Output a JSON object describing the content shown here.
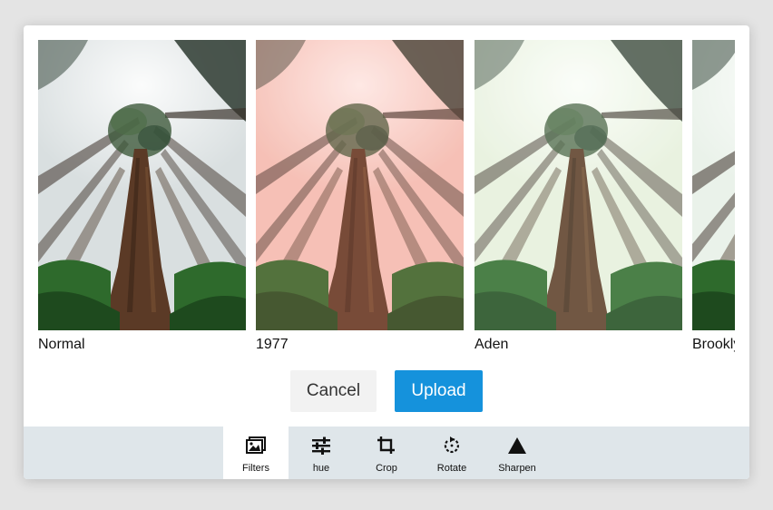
{
  "filters": [
    {
      "name": "Normal",
      "tint": "#d9dfe0"
    },
    {
      "name": "1977",
      "tint": "#f4c9c0"
    },
    {
      "name": "Aden",
      "tint": "#e8f0df"
    },
    {
      "name": "Brookly",
      "tint": "#eaf2ea"
    }
  ],
  "actions": {
    "cancel": "Cancel",
    "upload": "Upload"
  },
  "toolbar": {
    "items": [
      {
        "label": "Filters",
        "icon": "images-icon",
        "active": true
      },
      {
        "label": "hue",
        "icon": "sliders-icon",
        "active": false
      },
      {
        "label": "Crop",
        "icon": "crop-icon",
        "active": false
      },
      {
        "label": "Rotate",
        "icon": "rotate-icon",
        "active": false
      },
      {
        "label": "Sharpen",
        "icon": "triangle-icon",
        "active": false
      }
    ]
  },
  "colors": {
    "accent": "#1592dc",
    "toolbar_bg": "#dfe6ea"
  }
}
